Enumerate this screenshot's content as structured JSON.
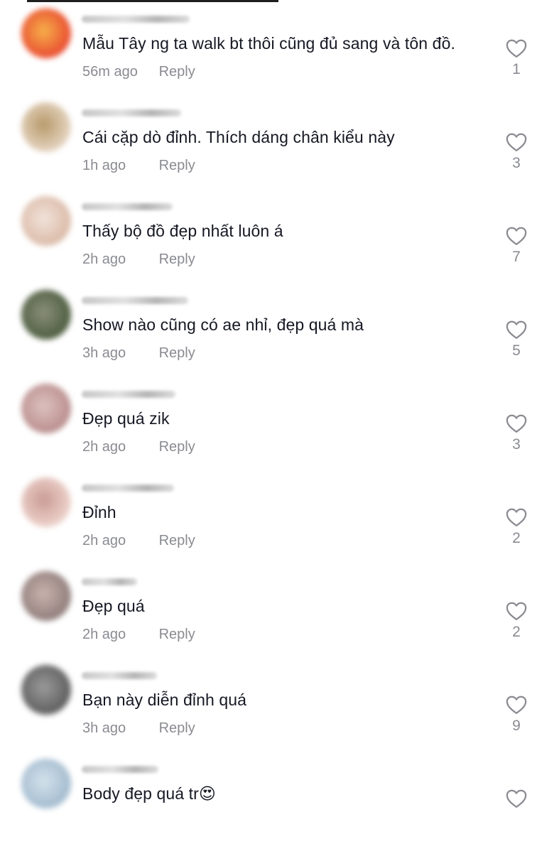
{
  "comments": [
    {
      "text": "Mẫu Tây ng ta walk bt thôi cũng đủ sang và tôn đồ.",
      "time": "56m ago",
      "reply": "Reply",
      "likes": "1",
      "avatar_colors": [
        "#e8452f",
        "#f6b04a"
      ]
    },
    {
      "text": "Cái cặp dò đỉnh. Thích dáng chân kiểu này",
      "time": "1h ago",
      "reply": "Reply",
      "likes": "3",
      "avatar_colors": [
        "#e9d9c8",
        "#b79a6a"
      ]
    },
    {
      "text": "Thấy bộ đồ đẹp nhất luôn á",
      "time": "2h ago",
      "reply": "Reply",
      "likes": "7",
      "avatar_colors": [
        "#d9b7a4",
        "#f1e3da"
      ]
    },
    {
      "text": "Show nào cũng có ae nhỉ, đẹp quá mà",
      "time": "3h ago",
      "reply": "Reply",
      "likes": "5",
      "avatar_colors": [
        "#4a5a3c",
        "#8a8f7a"
      ]
    },
    {
      "text": "Đẹp quá zik",
      "time": "2h ago",
      "reply": "Reply",
      "likes": "3",
      "avatar_colors": [
        "#b88a8a",
        "#dcc2c0"
      ]
    },
    {
      "text": "Đỉnh",
      "time": "2h ago",
      "reply": "Reply",
      "likes": "2",
      "avatar_colors": [
        "#f0d6cf",
        "#c99c95"
      ]
    },
    {
      "text": "Đẹp quá",
      "time": "2h ago",
      "reply": "Reply",
      "likes": "2",
      "avatar_colors": [
        "#8c7a78",
        "#c9b3ad"
      ]
    },
    {
      "text": "Bạn này diễn đỉnh quá",
      "time": "3h ago",
      "reply": "Reply",
      "likes": "9",
      "avatar_colors": [
        "#5a5a5a",
        "#9a9a9a"
      ]
    },
    {
      "text": "Body đẹp quá tr😍",
      "time": "",
      "reply": "",
      "likes": "",
      "avatar_colors": [
        "#9fb8cc",
        "#d4e2ec"
      ]
    }
  ]
}
